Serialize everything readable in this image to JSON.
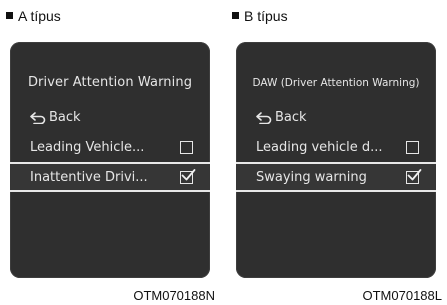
{
  "panel_a": {
    "label": "A típus",
    "title": "Driver Attention Warning",
    "back_label": "Back",
    "items": [
      {
        "label": "Leading Vehicle...",
        "checked": false
      },
      {
        "label": "Inattentive Drivi...",
        "checked": true
      }
    ],
    "code": "OTM070188N"
  },
  "panel_b": {
    "label": "B típus",
    "title": "DAW (Driver Attention Warning)",
    "back_label": "Back",
    "items": [
      {
        "label": "Leading vehicle d...",
        "checked": false
      },
      {
        "label": "Swaying warning",
        "checked": true
      }
    ],
    "code": "OTM070188L"
  },
  "icons": {
    "bullet": "square-bullet-icon",
    "back": "back-arrow-icon",
    "checkbox_empty": "checkbox-empty-icon",
    "checkbox_checked": "checkbox-checked-icon"
  },
  "colors": {
    "screen_background": "#2f2f2f",
    "screen_text": "#e6e6e6",
    "page_text": "#111111"
  }
}
